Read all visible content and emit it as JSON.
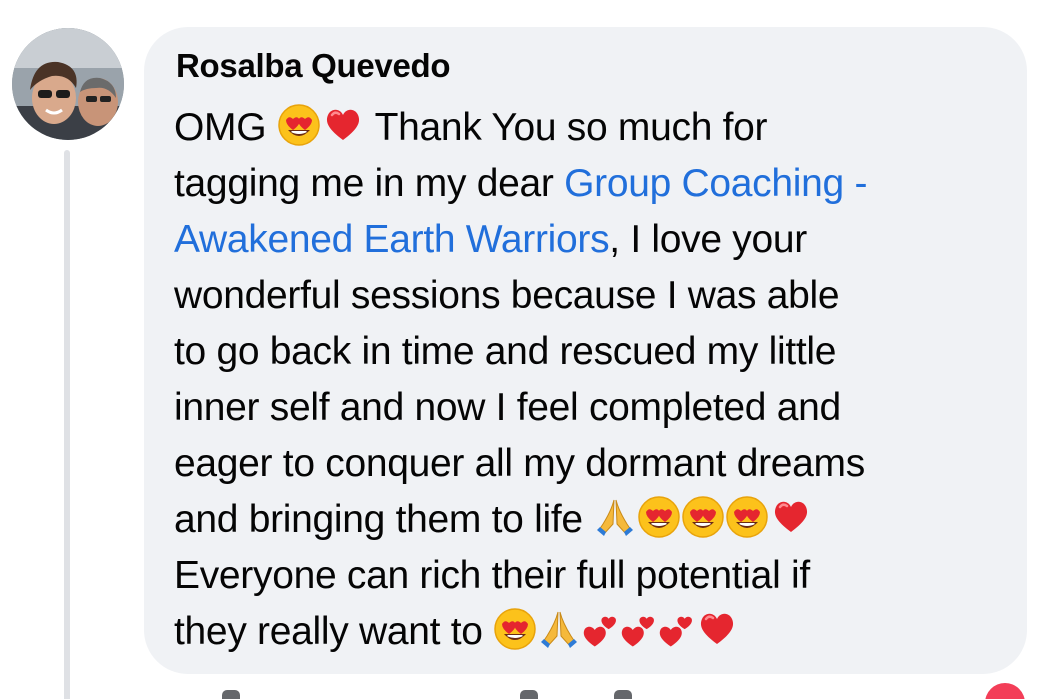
{
  "comment": {
    "author": "Rosalba Quevedo",
    "lines": [
      [
        {
          "t": "text",
          "v": "OMG "
        },
        {
          "t": "emoji",
          "v": "heart-eyes-emoji"
        },
        {
          "t": "emoji",
          "v": "red-heart-emoji"
        },
        {
          "t": "text",
          "v": " Thank You so much for"
        }
      ],
      [
        {
          "t": "text",
          "v": "tagging me in my dear "
        },
        {
          "t": "link",
          "v": "Group Coaching -"
        }
      ],
      [
        {
          "t": "link",
          "v": "Awakened Earth Warriors"
        },
        {
          "t": "text",
          "v": ", I love your"
        }
      ],
      [
        {
          "t": "text",
          "v": "wonderful sessions  because I was able"
        }
      ],
      [
        {
          "t": "text",
          "v": "to go back in time and rescued my little"
        }
      ],
      [
        {
          "t": "text",
          "v": "inner self and now I feel completed and"
        }
      ],
      [
        {
          "t": "text",
          "v": "eager to conquer all my dormant dreams"
        }
      ],
      [
        {
          "t": "text",
          "v": "and bringing them to life "
        },
        {
          "t": "emoji",
          "v": "folded-hands-emoji"
        },
        {
          "t": "emoji",
          "v": "heart-eyes-emoji"
        },
        {
          "t": "emoji",
          "v": "heart-eyes-emoji"
        },
        {
          "t": "emoji",
          "v": "heart-eyes-emoji"
        },
        {
          "t": "emoji",
          "v": "red-heart-emoji"
        }
      ],
      [
        {
          "t": "text",
          "v": "Everyone can rich their full potential if"
        }
      ],
      [
        {
          "t": "text",
          "v": "they really want to "
        },
        {
          "t": "emoji",
          "v": "heart-eyes-emoji"
        },
        {
          "t": "emoji",
          "v": "folded-hands-emoji"
        },
        {
          "t": "emoji",
          "v": "two-hearts-emoji"
        },
        {
          "t": "emoji",
          "v": "two-hearts-emoji"
        },
        {
          "t": "emoji",
          "v": "two-hearts-emoji"
        },
        {
          "t": "emoji",
          "v": "red-heart-emoji"
        }
      ]
    ]
  },
  "colors": {
    "bubble_bg": "#f0f2f5",
    "text": "#050505",
    "link": "#216fdb",
    "thread_line": "#dfe1e5"
  }
}
